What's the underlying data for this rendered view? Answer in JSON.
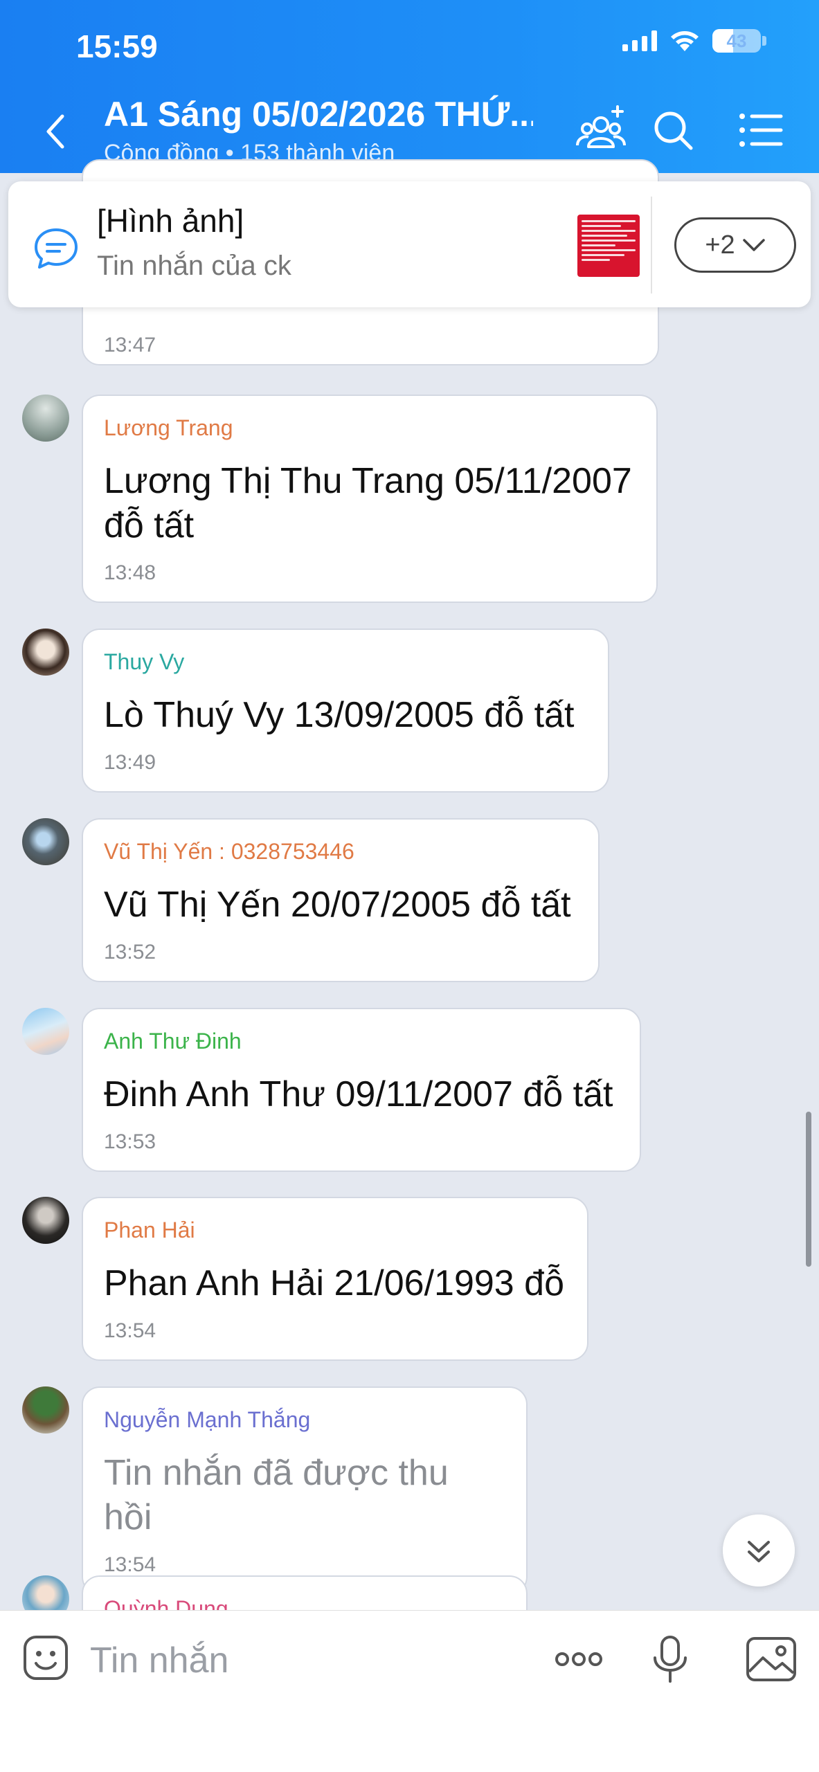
{
  "status": {
    "time": "15:59",
    "battery": "43"
  },
  "header": {
    "title": "A1 Sáng 05/02/2026 THỨ...",
    "subtitle": "Cộng đồng • 153 thành viên"
  },
  "pinned": {
    "title": "[Hình ảnh]",
    "subtitle": "Tin nhắn của ck",
    "more_label": "+2"
  },
  "messages": [
    {
      "time": "13:47"
    },
    {
      "sender": "Lương Trang",
      "sender_color": "#e07a45",
      "text_line1": "Lương Thị Thu Trang 05/11/2007",
      "text_line2": "đỗ tất",
      "time": "13:48"
    },
    {
      "sender": "Thuy Vy",
      "sender_color": "#2aa8a0",
      "text": "Lò Thuý Vy 13/09/2005 đỗ tất",
      "time": "13:49"
    },
    {
      "sender": "Vũ Thị Yến  : 0328753446",
      "sender_color": "#e07a45",
      "text": "Vũ Thị Yến 20/07/2005 đỗ tất",
      "time": "13:52"
    },
    {
      "sender": "Anh Thư Đinh",
      "sender_color": "#3bb34a",
      "text": "Đinh Anh Thư 09/11/2007 đỗ tất",
      "time": "13:53"
    },
    {
      "sender": "Phan Hải",
      "sender_color": "#e07a45",
      "text": "Phan Anh Hải 21/06/1993 đỗ",
      "time": "13:54"
    },
    {
      "sender": "Nguyễn Mạnh Thắng",
      "sender_color": "#6a6fd0",
      "text": "Tin nhắn đã được thu hồi",
      "time": "13:54"
    },
    {
      "sender": "Quỳnh Dung",
      "sender_color": "#d84a7a"
    }
  ],
  "input": {
    "placeholder": "Tin nhắn"
  },
  "colors": {
    "header_blue": "#1e8ff7",
    "chat_bg": "#e4e8f0"
  }
}
